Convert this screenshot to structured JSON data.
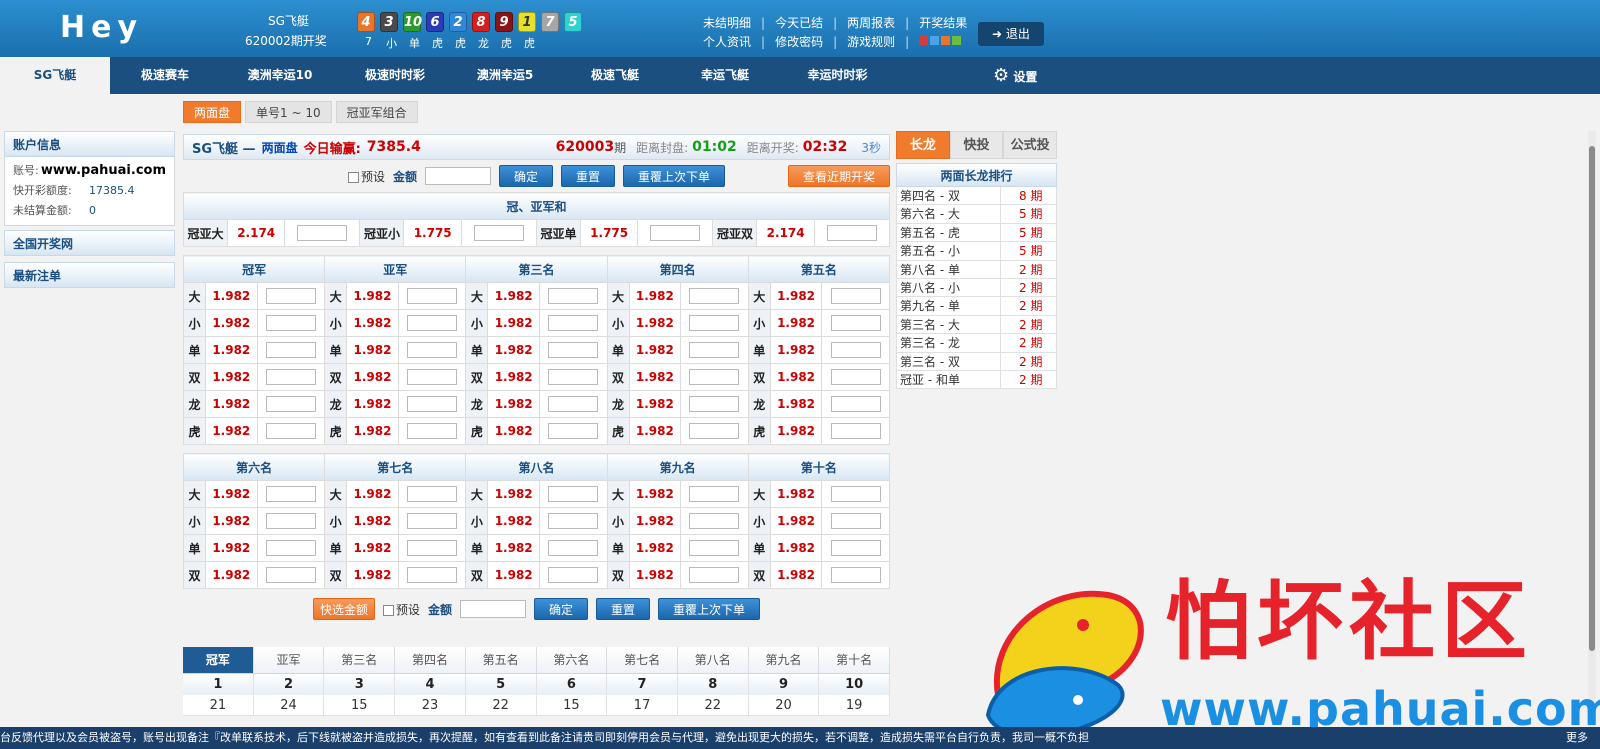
{
  "header": {
    "logo": "Hey",
    "lottery_name": "SG飞艇",
    "draw_line": "620002期开奖",
    "balls": [
      {
        "n": "4",
        "color": "#e8752a"
      },
      {
        "n": "3",
        "color": "#4a4a4a"
      },
      {
        "n": "10",
        "color": "#2c9a2c"
      },
      {
        "n": "6",
        "color": "#2a3bb5"
      },
      {
        "n": "2",
        "color": "#2f88d9"
      },
      {
        "n": "8",
        "color": "#d51e1e"
      },
      {
        "n": "9",
        "color": "#8a1414"
      },
      {
        "n": "1",
        "color": "#e5e02a"
      },
      {
        "n": "7",
        "color": "#a6a6a6"
      },
      {
        "n": "5",
        "color": "#2fd1d1"
      }
    ],
    "ball_subs": [
      "7",
      "小",
      "单",
      "虎",
      "虎",
      "龙",
      "虎",
      "虎"
    ],
    "links": [
      "未结明细",
      "今天已结",
      "两周报表",
      "开奖结果",
      "个人资讯",
      "修改密码",
      "游戏规则"
    ],
    "swatches": [
      "#d93a3a",
      "#4aa3ea",
      "#e8752a",
      "#6bbf3c"
    ],
    "logout": "退出"
  },
  "nav": {
    "tabs": [
      "SG飞艇",
      "极速赛车",
      "澳洲幸运10",
      "极速时时彩",
      "澳洲幸运5",
      "极速飞艇",
      "幸运飞艇",
      "幸运时时彩"
    ],
    "settings": "设置"
  },
  "subtabs": [
    "两面盘",
    "单号1 ~ 10",
    "冠亚军组合"
  ],
  "sidebar": {
    "account_title": "账户信息",
    "account_label": "账号:",
    "account_value": "www.pahuai.com",
    "quota_label": "快开彩额度:",
    "quota_value": "17385.4",
    "unsettled_label": "未结算金额:",
    "unsettled_value": "0",
    "link1": "全国开奖网",
    "link2": "最新注单"
  },
  "infobar": {
    "name": "SG飞艇 —",
    "mode": "两面盘",
    "win_label": "今日输赢:",
    "win_value": "7385.4",
    "period": "620003",
    "period_suffix": "期",
    "close_label": "距离封盘:",
    "close_value": "01:02",
    "draw_label": "距离开奖:",
    "draw_value": "02:32",
    "refresh": "3秒"
  },
  "betbar": {
    "preset": "预设",
    "amount": "金额",
    "confirm": "确定",
    "reset": "重置",
    "repeat": "重覆上次下单",
    "recent": "查看近期开奖",
    "quick": "快选金额"
  },
  "sum_section": {
    "title": "冠、亚军和",
    "items": [
      {
        "label": "冠亚大",
        "odds": "2.174"
      },
      {
        "label": "冠亚小",
        "odds": "1.775"
      },
      {
        "label": "冠亚单",
        "odds": "1.775"
      },
      {
        "label": "冠亚双",
        "odds": "2.174"
      }
    ]
  },
  "top5": {
    "headers": [
      "冠军",
      "亚军",
      "第三名",
      "第四名",
      "第五名"
    ],
    "rows": [
      "大",
      "小",
      "单",
      "双",
      "龙",
      "虎"
    ],
    "odds": "1.982"
  },
  "bottom5": {
    "headers": [
      "第六名",
      "第七名",
      "第八名",
      "第九名",
      "第十名"
    ],
    "rows": [
      "大",
      "小",
      "单",
      "双"
    ],
    "odds": "1.982"
  },
  "history": {
    "tabs": [
      "冠军",
      "亚军",
      "第三名",
      "第四名",
      "第五名",
      "第六名",
      "第七名",
      "第八名",
      "第九名",
      "第十名"
    ],
    "numbers": [
      "1",
      "2",
      "3",
      "4",
      "5",
      "6",
      "7",
      "8",
      "9",
      "10"
    ],
    "counts": [
      "21",
      "24",
      "15",
      "23",
      "22",
      "15",
      "17",
      "22",
      "20",
      "19"
    ]
  },
  "right": {
    "tabs": [
      "长龙",
      "快投",
      "公式投"
    ],
    "rank_title": "两面长龙排行",
    "rank": [
      {
        "n": "第四名 - 双",
        "v": "8 期"
      },
      {
        "n": "第六名 - 大",
        "v": "5 期"
      },
      {
        "n": "第五名 - 虎",
        "v": "5 期"
      },
      {
        "n": "第五名 - 小",
        "v": "5 期"
      },
      {
        "n": "第八名 - 单",
        "v": "2 期"
      },
      {
        "n": "第八名 - 小",
        "v": "2 期"
      },
      {
        "n": "第九名 - 单",
        "v": "2 期"
      },
      {
        "n": "第三名 - 大",
        "v": "2 期"
      },
      {
        "n": "第三名 - 龙",
        "v": "2 期"
      },
      {
        "n": "第三名 - 双",
        "v": "2 期"
      },
      {
        "n": "冠亚 - 和单",
        "v": "2 期"
      }
    ]
  },
  "ticker": {
    "text": "台反馈代理以及会员被盗号，账号出现备注『改单联系技术，后下线就被盗并造成损失，再次提醒，如有查看到此备注请贵司即刻停用会员与代理，避免出现更大的损失，若不调整，造成损失需平台自行负责，我司一概不负担",
    "more": "更多"
  },
  "watermark": {
    "title": "怕坏社区",
    "url": "www.pahuai.com"
  }
}
